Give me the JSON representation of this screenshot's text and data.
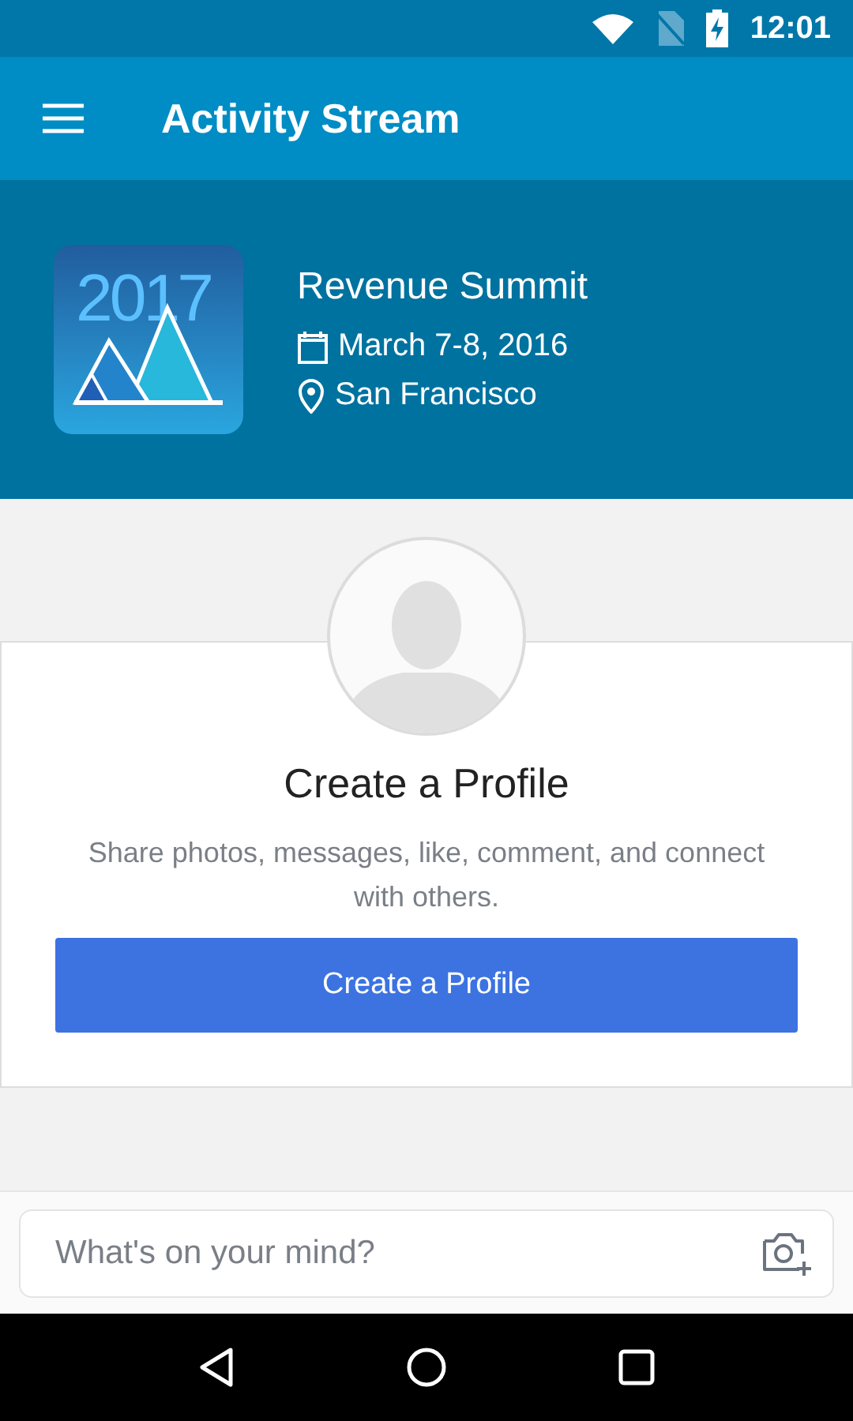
{
  "status_bar": {
    "time": "12:01"
  },
  "app_bar": {
    "title": "Activity Stream"
  },
  "event": {
    "logo_text": "2017",
    "name": "Revenue Summit",
    "date": "March 7-8, 2016",
    "location": "San Francisco"
  },
  "profile_card": {
    "title": "Create a Profile",
    "description": "Share photos, messages, like, comment, and connect with others.",
    "button": "Create a Profile"
  },
  "composer": {
    "placeholder": "What's on your mind?"
  }
}
